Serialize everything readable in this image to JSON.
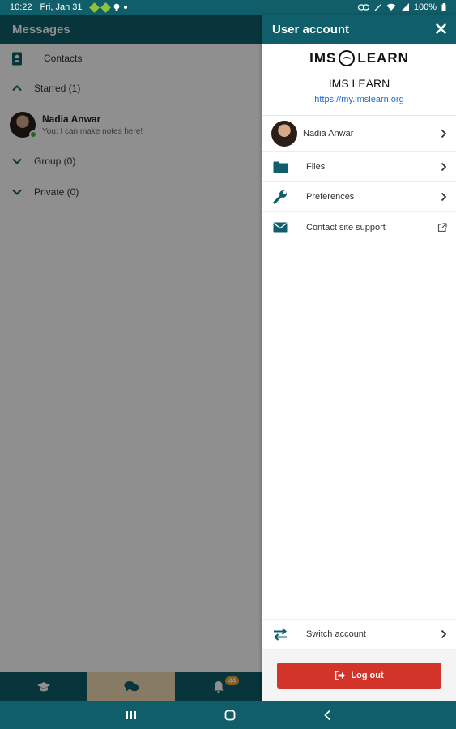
{
  "status_bar": {
    "time": "10:22",
    "date": "Fri, Jan 31",
    "battery": "100%"
  },
  "messages": {
    "title": "Messages",
    "contacts_label": "Contacts",
    "sections": [
      {
        "label": "Starred (1)",
        "expanded": true
      },
      {
        "label": "Group (0)",
        "expanded": false
      },
      {
        "label": "Private (0)",
        "expanded": false
      }
    ],
    "conversation": {
      "name": "Nadia Anwar",
      "snippet": "You: I can make notes here!",
      "online": true
    }
  },
  "bottom_nav": {
    "items": [
      "courses-icon",
      "messages-icon",
      "notifications-icon"
    ],
    "notifications_badge": "44"
  },
  "drawer": {
    "title": "User account",
    "logo_left": "IMS",
    "logo_right": "LEARN",
    "site_name": "IMS LEARN",
    "site_url": "https://my.imslearn.org",
    "user_name": "Nadia Anwar",
    "menu": {
      "files": "Files",
      "preferences": "Preferences",
      "contact_support": "Contact site support"
    },
    "switch_account": "Switch account",
    "logout": "Log out"
  },
  "colors": {
    "primary": "#0f5e69",
    "accent_tab": "#f3dbb4",
    "logout": "#d2342a",
    "link": "#2a6dbf",
    "badge": "#f3a82a",
    "online": "#3fb24f"
  }
}
